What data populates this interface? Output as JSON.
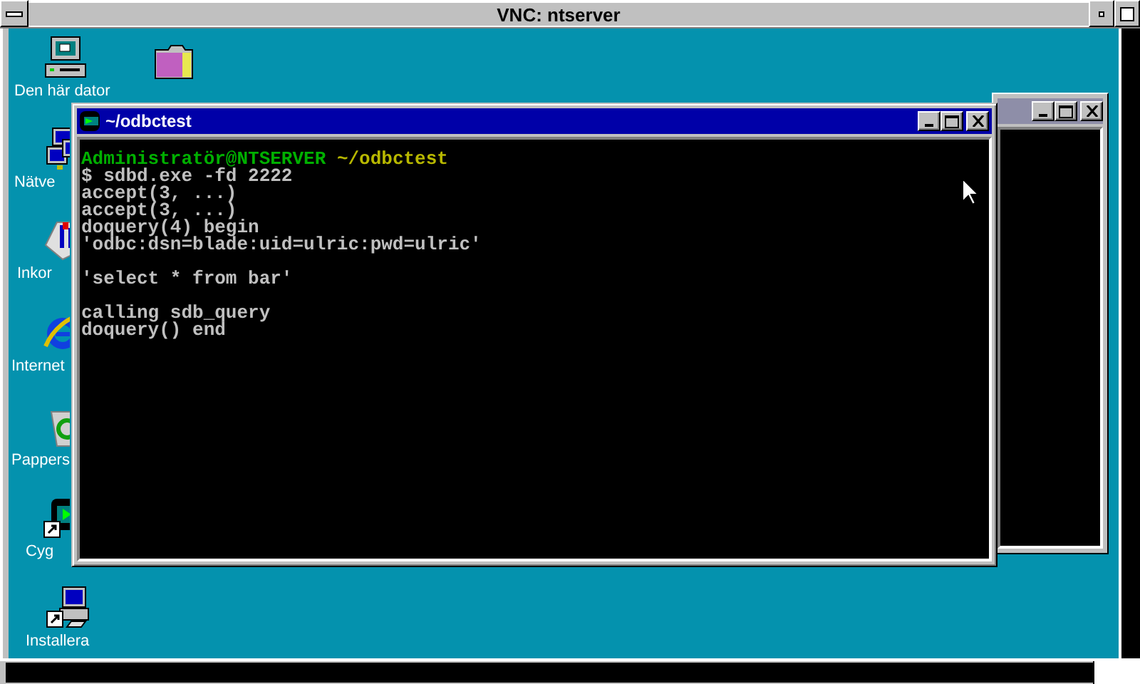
{
  "vnc_window": {
    "title": "VNC: ntserver"
  },
  "desktop_icons": [
    {
      "kind": "computer",
      "label": "Den här dator"
    },
    {
      "kind": "folder"
    },
    {
      "kind": "network",
      "label": "Nätve"
    },
    {
      "kind": "inbox",
      "label": "Inkor"
    },
    {
      "kind": "browser",
      "label": "Internet"
    },
    {
      "kind": "recycle",
      "label": "Pappers"
    },
    {
      "kind": "shell",
      "label": "Cyg"
    },
    {
      "kind": "setup",
      "label": "Installera"
    }
  ],
  "terminal": {
    "title": "~/odbctest",
    "lines": [
      {
        "kind": "prompt",
        "user": "Administratör@NTSERVER",
        "path": "~/odbctest"
      },
      {
        "kind": "output",
        "text": "$ sdbd.exe -fd 2222"
      },
      {
        "kind": "output",
        "text": "accept(3, ...)"
      },
      {
        "kind": "output",
        "text": "accept(3, ...)"
      },
      {
        "kind": "output",
        "text": "doquery(4) begin"
      },
      {
        "kind": "output",
        "text": "'odbc:dsn=blade:uid=ulric:pwd=ulric'"
      },
      {
        "kind": "blank"
      },
      {
        "kind": "output",
        "text": "'select * from bar'"
      },
      {
        "kind": "blank"
      },
      {
        "kind": "output",
        "text": "calling sdb_query"
      },
      {
        "kind": "output",
        "text": "doquery() end"
      }
    ]
  }
}
